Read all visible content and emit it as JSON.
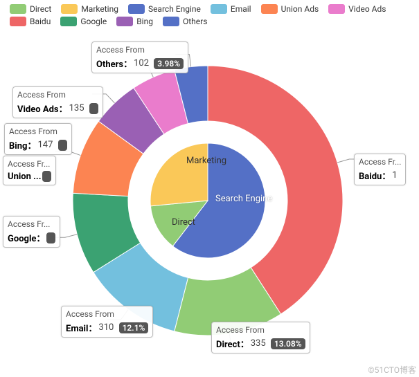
{
  "legend": [
    {
      "label": "Direct",
      "color": "#91cc75"
    },
    {
      "label": "Marketing",
      "color": "#fac858"
    },
    {
      "label": "Search Engine",
      "color": "#5470c6"
    },
    {
      "label": "Email",
      "color": "#73c0de"
    },
    {
      "label": "Union Ads",
      "color": "#fc8452"
    },
    {
      "label": "Video Ads",
      "color": "#ea7ccc"
    },
    {
      "label": "Baidu",
      "color": "#ee6666"
    },
    {
      "label": "Google",
      "color": "#3ba272"
    },
    {
      "label": "Bing",
      "color": "#9a60b4"
    },
    {
      "label": "Others",
      "color": "#5470c6"
    }
  ],
  "tooltip_title": "Access From",
  "tooltip_title_trunc": "Access Fr...",
  "cards": {
    "others": {
      "title": "Access From",
      "cat": "Others：",
      "val": "102",
      "pct": "3.98%"
    },
    "video": {
      "title": "Access From",
      "cat": "Video Ads：",
      "val": "135"
    },
    "bing": {
      "title": "Access From",
      "cat": "Bing：",
      "val": "147"
    },
    "union": {
      "title": "Access Fr...",
      "cat": "Union ..."
    },
    "google": {
      "title": "Access Fr...",
      "cat": "Google："
    },
    "email": {
      "title": "Access From",
      "cat": "Email：",
      "val": "310",
      "pct": "12.1%"
    },
    "direct": {
      "title": "Access From",
      "cat": "Direct：",
      "val": "335",
      "pct": "13.08%"
    },
    "baidu": {
      "title": "Access Fr...",
      "cat": "Baidu：",
      "val": "1"
    }
  },
  "inner_labels": {
    "marketing": "Marketing",
    "search": "Search Engine",
    "direct": "Direct"
  },
  "watermark": "©51CTO博客",
  "chart_data": [
    {
      "type": "pie",
      "role": "inner",
      "series_name": "Access From",
      "series": [
        {
          "name": "Search Engine",
          "value": 1548,
          "color": "#5470c6"
        },
        {
          "name": "Direct",
          "value": 335,
          "color": "#91cc75"
        },
        {
          "name": "Marketing",
          "value": 679,
          "color": "#fac858"
        }
      ]
    },
    {
      "type": "pie",
      "role": "outer-donut",
      "series_name": "Access From",
      "series": [
        {
          "name": "Baidu",
          "value": 1048,
          "color": "#ee6666"
        },
        {
          "name": "Direct",
          "value": 335,
          "color": "#91cc75"
        },
        {
          "name": "Email",
          "value": 310,
          "color": "#73c0de"
        },
        {
          "name": "Google",
          "value": 251,
          "color": "#3ba272"
        },
        {
          "name": "Union Ads",
          "value": 234,
          "color": "#fc8452"
        },
        {
          "name": "Bing",
          "value": 147,
          "color": "#9a60b4"
        },
        {
          "name": "Video Ads",
          "value": 135,
          "color": "#ea7ccc"
        },
        {
          "name": "Others",
          "value": 102,
          "color": "#5470c6"
        }
      ]
    }
  ]
}
